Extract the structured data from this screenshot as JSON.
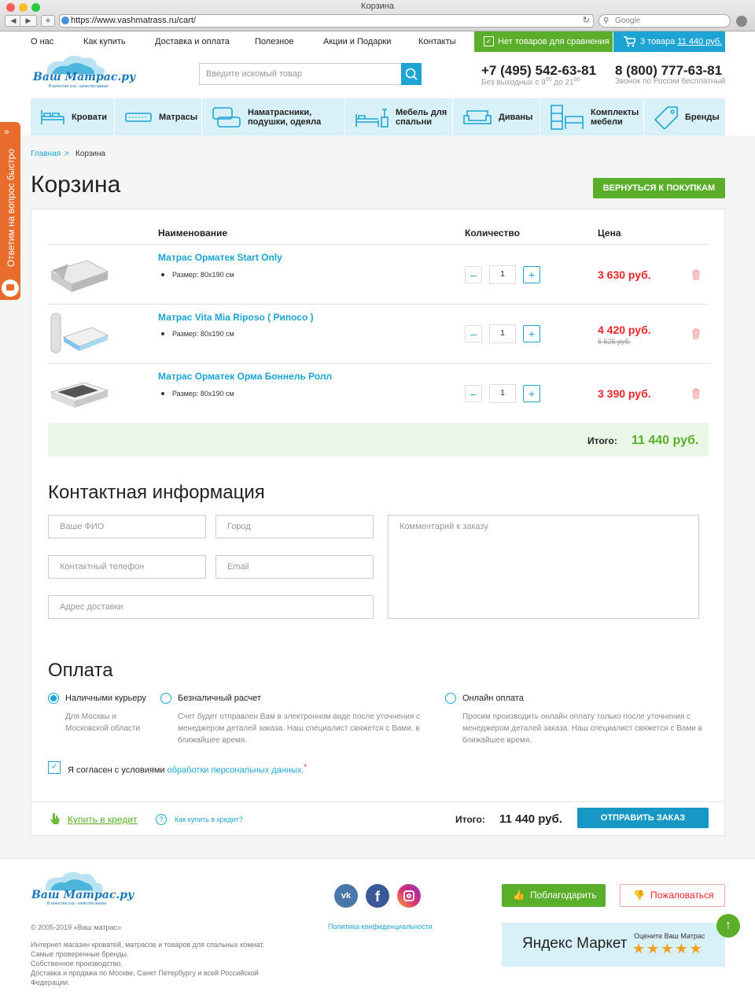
{
  "browser": {
    "title": "Корзина",
    "url": "https://www.vashmatrass.ru/cart/",
    "search_placeholder": "Google"
  },
  "topnav": [
    "О нас",
    "Как купить",
    "Доставка и оплата",
    "Полезное",
    "Акции и Подарки",
    "Контакты"
  ],
  "compare": "Нет товаров для сравнения",
  "cart": {
    "count": "3 товара",
    "sum": "11 440 руб."
  },
  "logo": {
    "text": "Ваш Матрас.ру",
    "tagline": "В качестве сна - качество жизни"
  },
  "search": {
    "placeholder": "Введите искомый товар"
  },
  "phones": [
    {
      "number": "+7 (495) 542-63-81",
      "note": "Без выходных с 9",
      "note_sup1": "00",
      "note_mid": " до 21",
      "note_sup2": "00"
    },
    {
      "number": "8 (800) 777-63-81",
      "note": "Звонок по России бесплатный"
    }
  ],
  "categories": [
    "Кровати",
    "Матрасы",
    "Наматрасники, подушки, одеяла",
    "Мебель для спальни",
    "Диваны",
    "Комплекты мебели",
    "Бренды"
  ],
  "sidetab": "Ответим на вопрос быстро",
  "breadcrumb": {
    "home": "Главная",
    "sep": ">",
    "current": "Корзина"
  },
  "page_title": "Корзина",
  "back_button": "ВЕРНУТЬСЯ К ПОКУПКАМ",
  "table": {
    "headers": {
      "name": "Наименование",
      "qty": "Количество",
      "price": "Цена"
    },
    "items": [
      {
        "name": "Матрас Орматек Start Only",
        "size": "Размер: 80х190 см",
        "qty": "1",
        "price": "3 630 руб.",
        "old_price": ""
      },
      {
        "name": "Матрас Vita Mia Riposo ( Рипосо )",
        "size": "Размер: 80х190 см",
        "qty": "1",
        "price": "4 420 руб.",
        "old_price": "5 525 руб."
      },
      {
        "name": "Матрас Орматек Орма Боннель Ролл",
        "size": "Размер: 80х190 см",
        "qty": "1",
        "price": "3 390 руб.",
        "old_price": ""
      }
    ],
    "total_label": "Итого:",
    "total_value": "11 440 руб."
  },
  "contact": {
    "title": "Контактная информация",
    "fio": "Ваше ФИО",
    "city": "Город",
    "phone": "Контактный телефон",
    "email": "Email",
    "address": "Адрес доставки",
    "comment": "Комментарий к заказу"
  },
  "payment": {
    "title": "Оплата",
    "options": [
      {
        "label": "Наличными курьеру",
        "desc": "Для Москвы и Московской области",
        "selected": true
      },
      {
        "label": "Безналичный расчет",
        "desc": "Счет будет отправлен Вам в электронном виде после уточнения с менеджером деталей заказа. Наш специалист свяжется с Вами. в ближайшее время.",
        "selected": false
      },
      {
        "label": "Онлайн оплата",
        "desc": "Просим производить онлайн оплату только после уточнения с менеджером деталей заказа. Наш специалист свяжется с Вами в ближайшее время.",
        "selected": false
      }
    ],
    "agree_text": "Я согласен с условиями ",
    "agree_link": "обработки персональных данных."
  },
  "bottom": {
    "credit": "Купить в кредит",
    "how_credit": "Как купить в кредит?",
    "total_label": "Итого:",
    "total_value": "11 440 руб.",
    "send": "ОТПРАВИТЬ ЗАКАЗ"
  },
  "footer": {
    "copyright": "© 2005-2019 «Ваш матрас»",
    "lines": [
      "Интернет магазин кроватей, матрасов и товаров для спальных комнат.",
      "Самые проверенные бренды.",
      "Собственное производство.",
      "Доставка и продажа по Москве, Санкт Петербургу и всей Российской",
      "Федерации."
    ],
    "privacy": "Политика конфиденциальности",
    "thanks": "Поблагодарить",
    "complain": "Пожаловаться",
    "ym_logo": "Яндекс Маркет",
    "ym_rate": "Оцените Ваш Матрас",
    "stars": 5,
    "up": "↑"
  },
  "colors": {
    "accent_blue": "#1ea4d3",
    "green": "#5aae2a",
    "red_price": "#e8262c",
    "orange_tab": "#e86c2b"
  }
}
